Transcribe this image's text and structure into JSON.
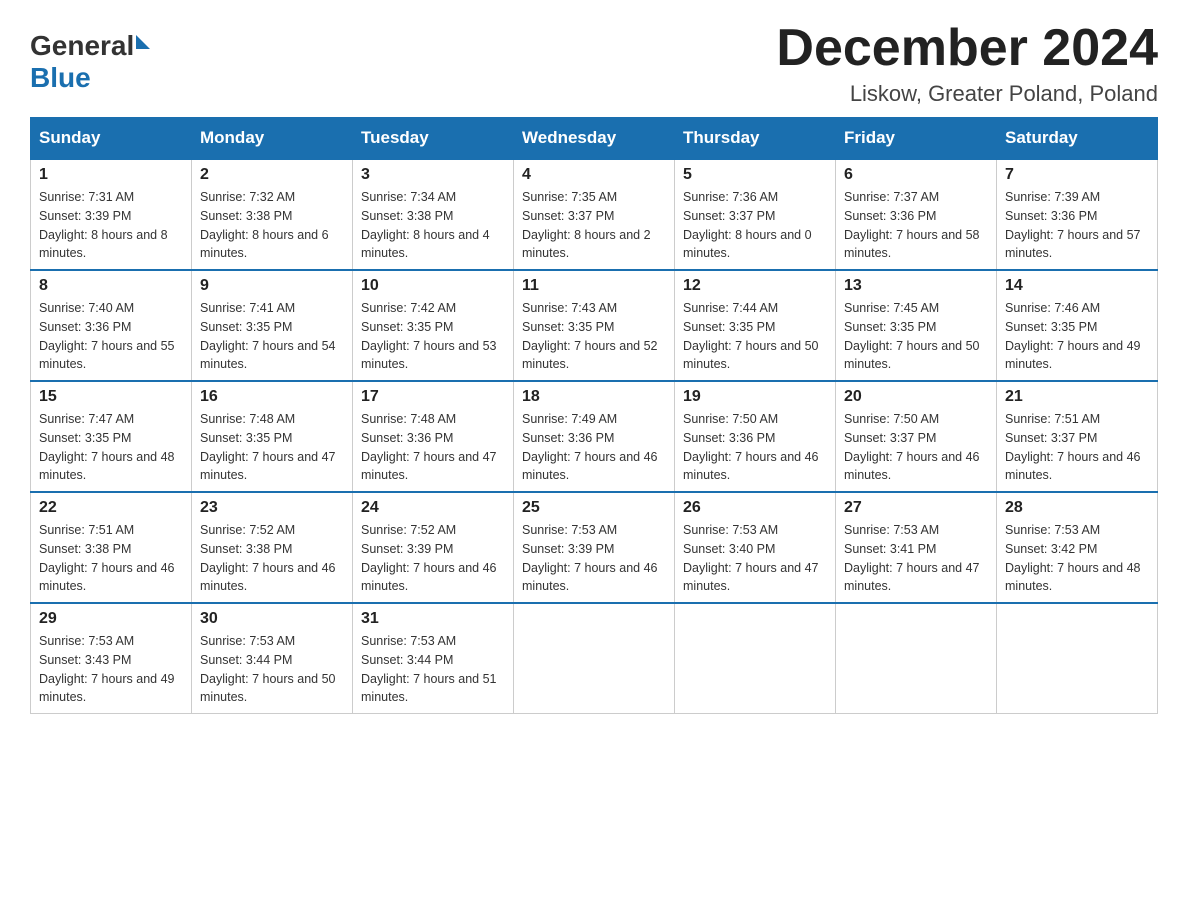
{
  "logo": {
    "text_general": "General",
    "text_blue": "Blue"
  },
  "header": {
    "title": "December 2024",
    "subtitle": "Liskow, Greater Poland, Poland"
  },
  "days_of_week": [
    "Sunday",
    "Monday",
    "Tuesday",
    "Wednesday",
    "Thursday",
    "Friday",
    "Saturday"
  ],
  "weeks": [
    [
      {
        "day": "1",
        "sunrise": "7:31 AM",
        "sunset": "3:39 PM",
        "daylight": "8 hours and 8 minutes."
      },
      {
        "day": "2",
        "sunrise": "7:32 AM",
        "sunset": "3:38 PM",
        "daylight": "8 hours and 6 minutes."
      },
      {
        "day": "3",
        "sunrise": "7:34 AM",
        "sunset": "3:38 PM",
        "daylight": "8 hours and 4 minutes."
      },
      {
        "day": "4",
        "sunrise": "7:35 AM",
        "sunset": "3:37 PM",
        "daylight": "8 hours and 2 minutes."
      },
      {
        "day": "5",
        "sunrise": "7:36 AM",
        "sunset": "3:37 PM",
        "daylight": "8 hours and 0 minutes."
      },
      {
        "day": "6",
        "sunrise": "7:37 AM",
        "sunset": "3:36 PM",
        "daylight": "7 hours and 58 minutes."
      },
      {
        "day": "7",
        "sunrise": "7:39 AM",
        "sunset": "3:36 PM",
        "daylight": "7 hours and 57 minutes."
      }
    ],
    [
      {
        "day": "8",
        "sunrise": "7:40 AM",
        "sunset": "3:36 PM",
        "daylight": "7 hours and 55 minutes."
      },
      {
        "day": "9",
        "sunrise": "7:41 AM",
        "sunset": "3:35 PM",
        "daylight": "7 hours and 54 minutes."
      },
      {
        "day": "10",
        "sunrise": "7:42 AM",
        "sunset": "3:35 PM",
        "daylight": "7 hours and 53 minutes."
      },
      {
        "day": "11",
        "sunrise": "7:43 AM",
        "sunset": "3:35 PM",
        "daylight": "7 hours and 52 minutes."
      },
      {
        "day": "12",
        "sunrise": "7:44 AM",
        "sunset": "3:35 PM",
        "daylight": "7 hours and 50 minutes."
      },
      {
        "day": "13",
        "sunrise": "7:45 AM",
        "sunset": "3:35 PM",
        "daylight": "7 hours and 50 minutes."
      },
      {
        "day": "14",
        "sunrise": "7:46 AM",
        "sunset": "3:35 PM",
        "daylight": "7 hours and 49 minutes."
      }
    ],
    [
      {
        "day": "15",
        "sunrise": "7:47 AM",
        "sunset": "3:35 PM",
        "daylight": "7 hours and 48 minutes."
      },
      {
        "day": "16",
        "sunrise": "7:48 AM",
        "sunset": "3:35 PM",
        "daylight": "7 hours and 47 minutes."
      },
      {
        "day": "17",
        "sunrise": "7:48 AM",
        "sunset": "3:36 PM",
        "daylight": "7 hours and 47 minutes."
      },
      {
        "day": "18",
        "sunrise": "7:49 AM",
        "sunset": "3:36 PM",
        "daylight": "7 hours and 46 minutes."
      },
      {
        "day": "19",
        "sunrise": "7:50 AM",
        "sunset": "3:36 PM",
        "daylight": "7 hours and 46 minutes."
      },
      {
        "day": "20",
        "sunrise": "7:50 AM",
        "sunset": "3:37 PM",
        "daylight": "7 hours and 46 minutes."
      },
      {
        "day": "21",
        "sunrise": "7:51 AM",
        "sunset": "3:37 PM",
        "daylight": "7 hours and 46 minutes."
      }
    ],
    [
      {
        "day": "22",
        "sunrise": "7:51 AM",
        "sunset": "3:38 PM",
        "daylight": "7 hours and 46 minutes."
      },
      {
        "day": "23",
        "sunrise": "7:52 AM",
        "sunset": "3:38 PM",
        "daylight": "7 hours and 46 minutes."
      },
      {
        "day": "24",
        "sunrise": "7:52 AM",
        "sunset": "3:39 PM",
        "daylight": "7 hours and 46 minutes."
      },
      {
        "day": "25",
        "sunrise": "7:53 AM",
        "sunset": "3:39 PM",
        "daylight": "7 hours and 46 minutes."
      },
      {
        "day": "26",
        "sunrise": "7:53 AM",
        "sunset": "3:40 PM",
        "daylight": "7 hours and 47 minutes."
      },
      {
        "day": "27",
        "sunrise": "7:53 AM",
        "sunset": "3:41 PM",
        "daylight": "7 hours and 47 minutes."
      },
      {
        "day": "28",
        "sunrise": "7:53 AM",
        "sunset": "3:42 PM",
        "daylight": "7 hours and 48 minutes."
      }
    ],
    [
      {
        "day": "29",
        "sunrise": "7:53 AM",
        "sunset": "3:43 PM",
        "daylight": "7 hours and 49 minutes."
      },
      {
        "day": "30",
        "sunrise": "7:53 AM",
        "sunset": "3:44 PM",
        "daylight": "7 hours and 50 minutes."
      },
      {
        "day": "31",
        "sunrise": "7:53 AM",
        "sunset": "3:44 PM",
        "daylight": "7 hours and 51 minutes."
      },
      null,
      null,
      null,
      null
    ]
  ]
}
